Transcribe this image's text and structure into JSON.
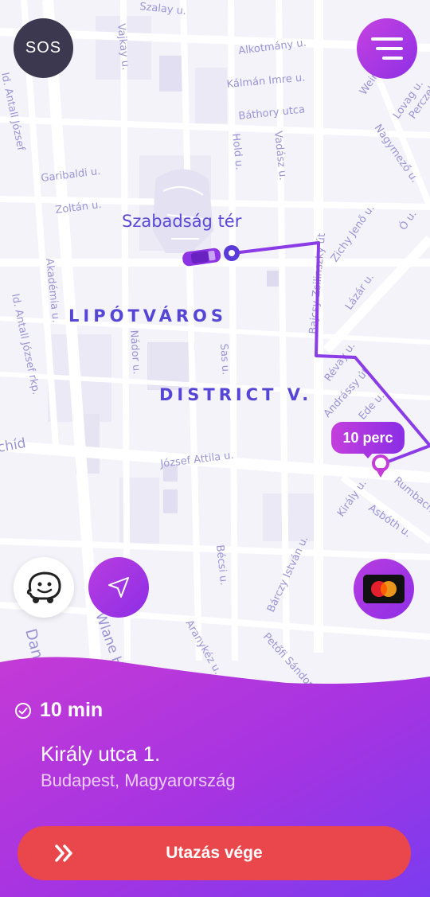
{
  "map": {
    "streets": [
      "Szalay u.",
      "Vajkay u.",
      "Alkotmány u.",
      "Kálmán Imre u.",
      "Báthory utca",
      "Weiner",
      "Lovag u.",
      "Nagymező u.",
      "Hold u.",
      "Vadász u.",
      "Garibaldi u.",
      "Zoltán u.",
      "Bajcsy-Zsilinszky út",
      "Zichy Jenő u.",
      "Ó u.",
      "Lázár u.",
      "Akadémia u.",
      "Id. Antall József rkp.",
      "Nádor u.",
      "Sas u.",
      "Révay u.",
      "Andrássy út",
      "Ede u.",
      "József Attila u.",
      "Király u.",
      "Rumbach",
      "Asbóth u.",
      "Bécsi u.",
      "Bárczy István u.",
      "Aranykéz u.",
      "Petőfi Sándor",
      "Danu",
      "Wlane Hai",
      "Id. Antall József",
      "chíd",
      "Perczel"
    ],
    "place_label": "Szabadság tér",
    "district_1": "LIPÓTVÁROS",
    "district_2": "DISTRICT V."
  },
  "buttons": {
    "sos_label": "SOS",
    "menu_icon": "menu-icon",
    "waze_icon": "waze-icon",
    "nav_icon": "navigation-arrow-icon",
    "payment_icon": "mastercard-icon"
  },
  "eta_bubble": "10 perc",
  "trip": {
    "eta": "10 min",
    "address_line1": "Király utca 1.",
    "address_line2": "Budapest, Magyarország",
    "end_button": "Utazás vége"
  },
  "colors": {
    "accent_purple": "#9b33e4",
    "route": "#8a3fe6",
    "end_button": "#e9474c",
    "sos": "#3b3850"
  }
}
